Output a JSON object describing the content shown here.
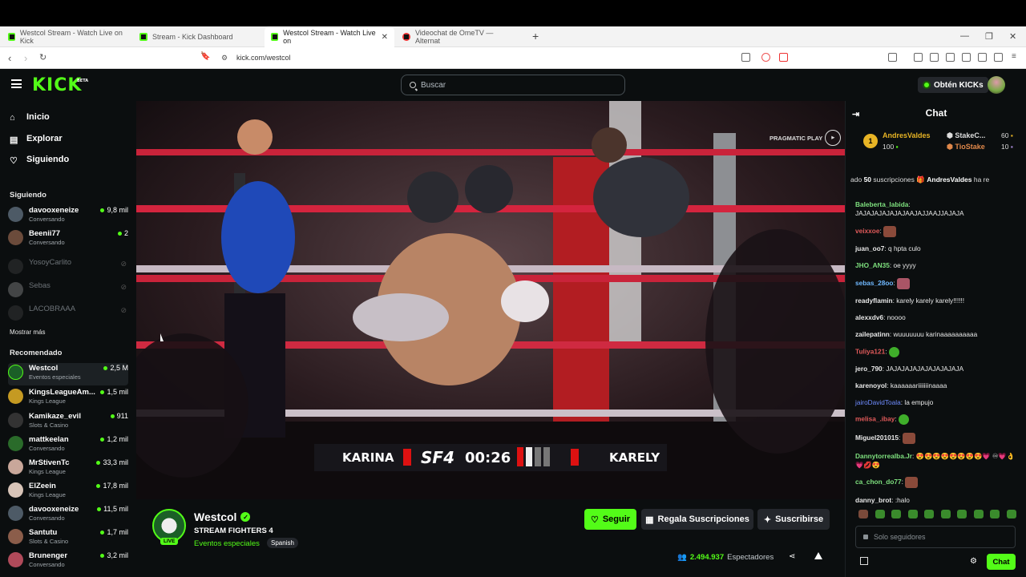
{
  "browser": {
    "tabs": [
      {
        "title": "Westcol Stream - Watch Live on Kick"
      },
      {
        "title": "Stream - Kick Dashboard"
      },
      {
        "title": "Westcol Stream - Watch Live on"
      },
      {
        "title": "Videochat de OmeTV — Alternat"
      }
    ],
    "url": "kick.com/westcol"
  },
  "header": {
    "logo": "KICK",
    "logo_tag": "BETA",
    "search_placeholder": "Buscar",
    "get_kicks": "Obtén KICKs"
  },
  "sidebar": {
    "nav": [
      {
        "label": "Inicio",
        "icon": "home-icon"
      },
      {
        "label": "Explorar",
        "icon": "compass-icon"
      },
      {
        "label": "Siguiendo",
        "icon": "heart-icon"
      }
    ],
    "following_title": "Siguiendo",
    "following": [
      {
        "name": "davooxeneize",
        "category": "Conversando",
        "viewers": "9,8 mil",
        "live": true
      },
      {
        "name": "Beenii77",
        "category": "Conversando",
        "viewers": "2",
        "live": true
      },
      {
        "name": "YosoyCarlito",
        "category": "",
        "viewers": "",
        "live": false
      },
      {
        "name": "Sebas",
        "category": "",
        "viewers": "",
        "live": false
      },
      {
        "name": "LACOBRAAA",
        "category": "",
        "viewers": "",
        "live": false
      }
    ],
    "show_more": "Mostrar más",
    "recommended_title": "Recomendado",
    "recommended": [
      {
        "name": "Westcol",
        "category": "Eventos especiales",
        "viewers": "2,5 M"
      },
      {
        "name": "KingsLeagueAm...",
        "category": "Kings League",
        "viewers": "1,5 mil"
      },
      {
        "name": "Kamikaze_evil",
        "category": "Slots & Casino",
        "viewers": "911"
      },
      {
        "name": "mattkeelan",
        "category": "Conversando",
        "viewers": "1,2 mil"
      },
      {
        "name": "MrStivenTc",
        "category": "Kings League",
        "viewers": "33,3 mil"
      },
      {
        "name": "ElZeein",
        "category": "Kings League",
        "viewers": "17,8 mil"
      },
      {
        "name": "davooxeneize",
        "category": "Conversando",
        "viewers": "11,5 mil"
      },
      {
        "name": "Santutu",
        "category": "Slots & Casino",
        "viewers": "1,7 mil"
      },
      {
        "name": "Brunenger",
        "category": "Conversando",
        "viewers": "3,2 mil"
      }
    ]
  },
  "player": {
    "fighter_left": "KARINA",
    "fighter_right": "KARELY",
    "event_logo": "SF4",
    "timer": "00:26",
    "sponsor": "PRAGMATIC PLAY"
  },
  "stream": {
    "streamer": "Westcol",
    "live_badge": "LIVE",
    "title": "STREAM FIGHTERS 4",
    "category": "Eventos especiales",
    "language": "Spanish",
    "follow_label": "Seguir",
    "gift_label": "Regala Suscripciones",
    "subscribe_label": "Suscribirse",
    "viewers": "2.494.937",
    "viewers_label": "Espectadores"
  },
  "chat": {
    "title": "Chat",
    "leaderboard": {
      "rank": "1",
      "top_name": "AndresValdes",
      "top_value": "100",
      "second_name": "StakeC...",
      "second_value": "60",
      "third_name": "TioStake",
      "third_value": "10"
    },
    "pinned": {
      "prefix": "ado",
      "count": "50",
      "text": "suscripciones",
      "name": "AndresValdes",
      "suffix": "ha re"
    },
    "messages": [
      {
        "user": "Baleberta_labida",
        "color": "#7ee07e",
        "text": "JAJAJAJAJAJAJAAJAJJAAJJAJAJA",
        "emote": false
      },
      {
        "user": "veixxoe",
        "color": "#e05a5a",
        "text": "",
        "emote": true
      },
      {
        "user": "juan_oo7",
        "color": "#e8e8e8",
        "text": "q hpta culo",
        "emote": false
      },
      {
        "user": "JHO_AN35",
        "color": "#7ee07e",
        "text": "oe yyyy",
        "emote": false
      },
      {
        "user": "sebas_28oo",
        "color": "#6fb8ff",
        "text": "",
        "emote": true
      },
      {
        "user": "readyflamin",
        "color": "#e8e8e8",
        "text": "karely karely karely!!!!!!",
        "emote": false
      },
      {
        "user": "alexxdv6",
        "color": "#e8e8e8",
        "text": "noooo",
        "emote": false
      },
      {
        "user": "zailepatinn",
        "color": "#e8e8e8",
        "text": "wuuuuuuu karinaaaaaaaaaa",
        "emote": false
      },
      {
        "user": "Tuliya121",
        "color": "#e05a5a",
        "text": "",
        "emote": true
      },
      {
        "user": "jero_790",
        "color": "#e8e8e8",
        "text": "JAJAJAJAJAJAJAJAJAJA",
        "emote": false
      },
      {
        "user": "karenoyol",
        "color": "#e8e8e8",
        "text": "kaaaaaariiiiiiinaaaa",
        "emote": false
      },
      {
        "user": "jairoDavidToala",
        "color": "#6f8cff",
        "text": "la empujo",
        "emote": false
      },
      {
        "user": "melisa_.ibay",
        "color": "#e05a5a",
        "text": "",
        "emote": true
      },
      {
        "user": "Miguel201015",
        "color": "#e8e8e8",
        "text": "",
        "emote": true
      },
      {
        "user": "Dannytorrealba.Jr",
        "color": "#7ee07e",
        "text": "😍😍😍😍😍😍😍😍💗 ♾💗👌💗💋😍",
        "emote": false
      },
      {
        "user": "ca_chon_do77",
        "color": "#7ee07e",
        "text": "",
        "emote": true
      },
      {
        "user": "danny_brot",
        "color": "#e8e8e8",
        "text": ":halo",
        "emote": false
      }
    ],
    "input_placeholder": "Solo seguidores",
    "send_label": "Chat"
  }
}
